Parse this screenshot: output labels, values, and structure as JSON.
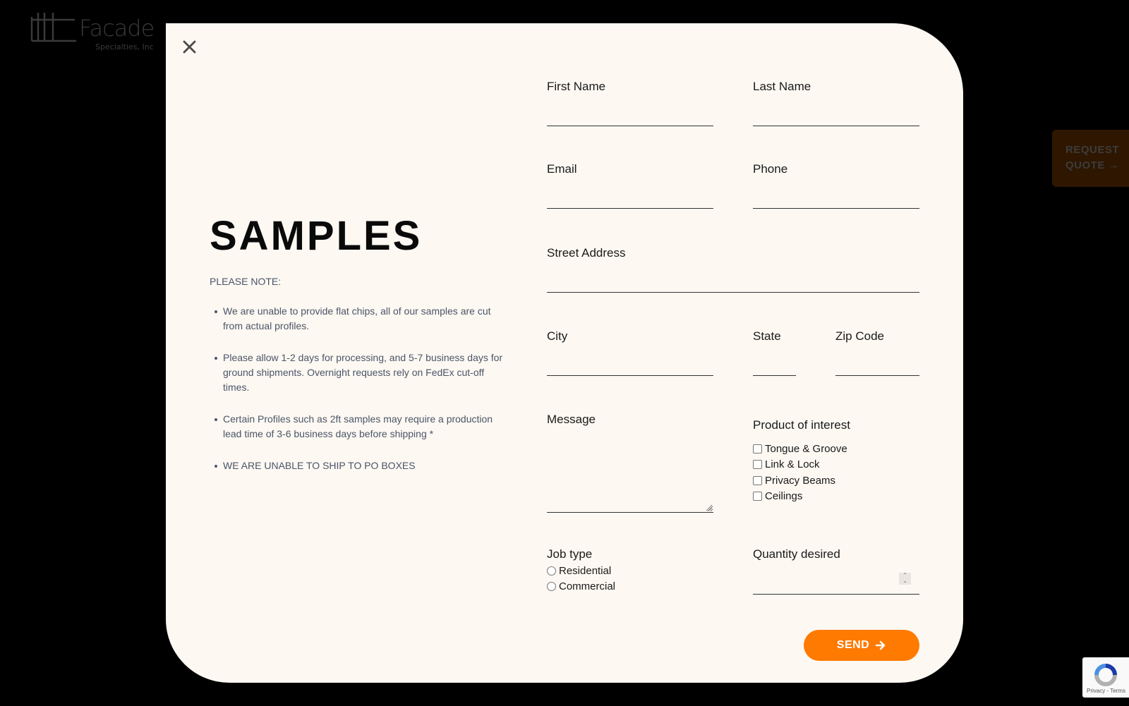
{
  "background": {
    "logo": {
      "name": "Facade",
      "subtitle": "Specialties, Inc"
    },
    "request_quote": {
      "line1": "REQUEST",
      "line2": "QUOTE →"
    }
  },
  "modal": {
    "close_icon": "close-icon",
    "title": "SAMPLES",
    "note_label": "PLEASE NOTE:",
    "notes": [
      "We are unable to provide flat chips, all of our samples are cut from actual profiles.",
      "Please allow 1-2 days for processing, and 5-7 business days for ground shipments. Overnight requests rely on FedEx cut-off times.",
      "Certain Profiles such as 2ft samples may require a production lead time of 3-6 business days before shipping *",
      "WE ARE UNABLE TO SHIP TO PO BOXES"
    ],
    "form": {
      "first_name": {
        "label": "First Name",
        "value": ""
      },
      "last_name": {
        "label": "Last Name",
        "value": ""
      },
      "email": {
        "label": "Email",
        "value": ""
      },
      "phone": {
        "label": "Phone",
        "value": ""
      },
      "street_address": {
        "label": "Street Address",
        "value": ""
      },
      "city": {
        "label": "City",
        "value": ""
      },
      "state": {
        "label": "State",
        "value": ""
      },
      "zip_code": {
        "label": "Zip Code",
        "value": ""
      },
      "message": {
        "label": "Message",
        "value": ""
      },
      "product_of_interest": {
        "label": "Product of interest",
        "options": [
          {
            "label": "Tongue & Groove",
            "checked": false
          },
          {
            "label": "Link & Lock",
            "checked": false
          },
          {
            "label": "Privacy Beams",
            "checked": false
          },
          {
            "label": "Ceilings",
            "checked": false
          }
        ]
      },
      "job_type": {
        "label": "Job type",
        "options": [
          {
            "label": "Residential",
            "selected": false
          },
          {
            "label": "Commercial",
            "selected": false
          }
        ]
      },
      "quantity": {
        "label": "Quantity desired",
        "value": ""
      },
      "send_label": "SEND",
      "send_color": "#ff7a00"
    }
  },
  "recaptcha": {
    "terms": "Privacy - Terms"
  }
}
